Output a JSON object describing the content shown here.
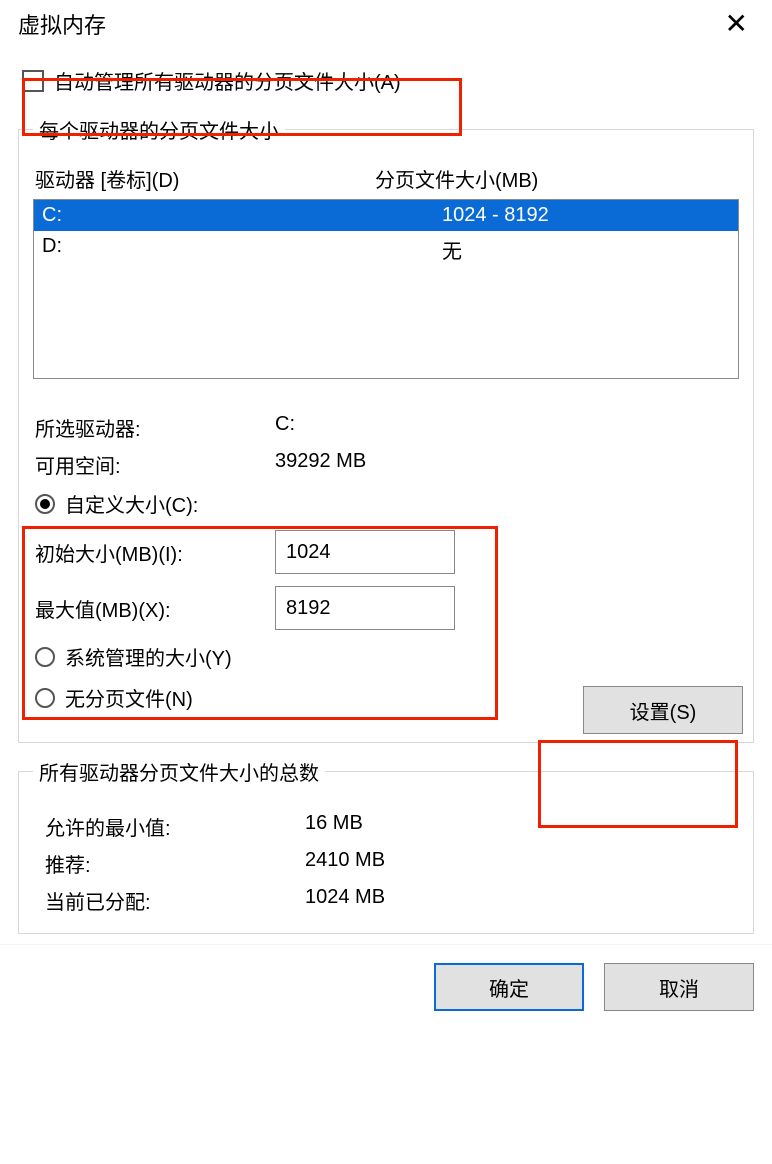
{
  "title": "虚拟内存",
  "auto_manage_label": "自动管理所有驱动器的分页文件大小(A)",
  "auto_manage_checked": false,
  "per_drive": {
    "legend": "每个驱动器的分页文件大小",
    "col_drive": "驱动器 [卷标](D)",
    "col_size": "分页文件大小(MB)",
    "rows": [
      {
        "drive": "C:",
        "size": "1024 - 8192",
        "selected": true
      },
      {
        "drive": "D:",
        "size": "无",
        "selected": false
      }
    ],
    "selected_drive_label": "所选驱动器:",
    "selected_drive_value": "C:",
    "free_space_label": "可用空间:",
    "free_space_value": "39292 MB",
    "radio_custom": "自定义大小(C):",
    "initial_label": "初始大小(MB)(I):",
    "initial_value": "1024",
    "max_label": "最大值(MB)(X):",
    "max_value": "8192",
    "radio_system": "系统管理的大小(Y)",
    "radio_none": "无分页文件(N)",
    "set_button": "设置(S)",
    "size_mode": "custom"
  },
  "totals": {
    "legend": "所有驱动器分页文件大小的总数",
    "min_label": "允许的最小值:",
    "min_value": "16 MB",
    "rec_label": "推荐:",
    "rec_value": "2410 MB",
    "cur_label": "当前已分配:",
    "cur_value": "1024 MB"
  },
  "footer": {
    "ok": "确定",
    "cancel": "取消"
  }
}
